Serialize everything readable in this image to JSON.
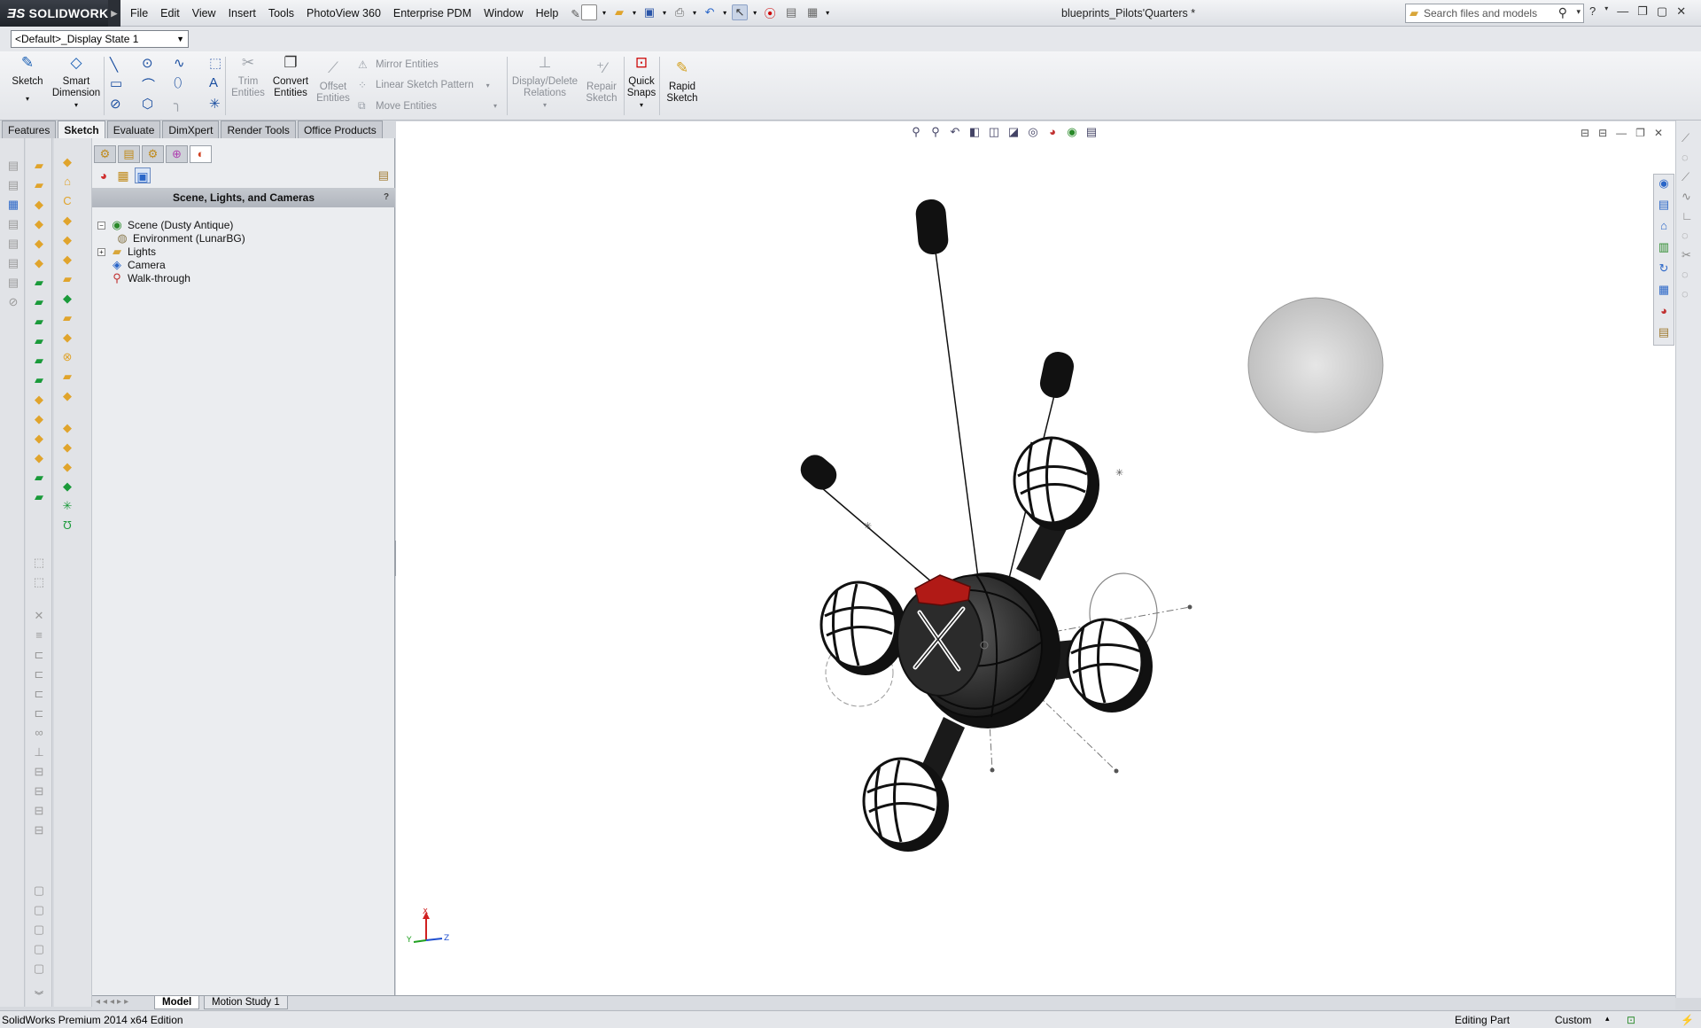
{
  "app": {
    "brand": "SOLIDWORKS",
    "menus": [
      "File",
      "Edit",
      "View",
      "Insert",
      "Tools",
      "PhotoView 360",
      "Enterprise PDM",
      "Window",
      "Help"
    ],
    "document_title": "blueprints_Pilots'Quarters *",
    "search_placeholder": "Search files and models"
  },
  "display_state": "<Default>_Display State 1",
  "command_manager": {
    "sketch": "Sketch",
    "smart_dimension": [
      "Smart",
      "Dimension"
    ],
    "trim_entities": [
      "Trim",
      "Entities"
    ],
    "convert_entities": [
      "Convert",
      "Entities"
    ],
    "offset_entities": [
      "Offset",
      "Entities"
    ],
    "mirror_entities": "Mirror Entities",
    "linear_sketch_pattern": "Linear Sketch Pattern",
    "move_entities": "Move Entities",
    "display_delete_relations": [
      "Display/Delete",
      "Relations"
    ],
    "repair_sketch": [
      "Repair",
      "Sketch"
    ],
    "quick_snaps": [
      "Quick",
      "Snaps"
    ],
    "rapid_sketch": [
      "Rapid",
      "Sketch"
    ]
  },
  "tabs": [
    "Features",
    "Sketch",
    "Evaluate",
    "DimXpert",
    "Render Tools",
    "Office Products"
  ],
  "active_tab": "Sketch",
  "panel": {
    "title": "Scene, Lights, and Cameras",
    "help": "?",
    "tree": [
      {
        "label": "Scene (Dusty Antique)",
        "icon": "scene-icon"
      },
      {
        "label": "Environment (LunarBG)",
        "icon": "environment-icon"
      },
      {
        "label": "Lights",
        "icon": "lights-folder-icon"
      },
      {
        "label": "Camera",
        "icon": "camera-icon"
      },
      {
        "label": "Walk-through",
        "icon": "walkthrough-icon"
      }
    ]
  },
  "bottom_tabs": [
    "Model",
    "Motion Study 1"
  ],
  "status": {
    "edition": "SolidWorks Premium 2014 x64 Edition",
    "mode": "Editing Part",
    "units": "Custom"
  },
  "triad": {
    "x": "X",
    "y": "Y",
    "z": "Z"
  },
  "colors": {
    "accent_red": "#b11a16",
    "body_dark": "#2e2e2e",
    "toolbar_blue": "#1a5fb4"
  }
}
